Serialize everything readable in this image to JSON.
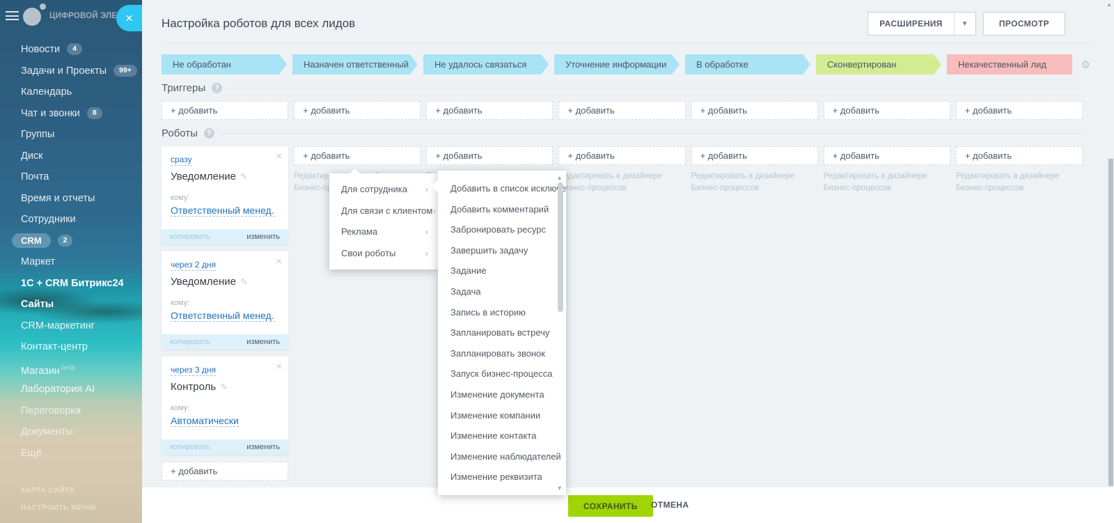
{
  "colors": {
    "stage_blue": "#a9e3f6",
    "stage_green": "#d3ec92",
    "stage_red": "#f9bcbc",
    "accent_cyan": "#2fc7f1",
    "save_green": "#9fd502",
    "link_blue": "#2272b9"
  },
  "sidebar": {
    "logo_text": "ЦИФРОВОЙ ЭЛЕМЕНТ",
    "items": [
      {
        "label": "Новости",
        "badge": "4"
      },
      {
        "label": "Задачи и Проекты",
        "badge": "99+"
      },
      {
        "label": "Календарь"
      },
      {
        "label": "Чат и звонки",
        "badge": "8"
      },
      {
        "label": "Группы"
      },
      {
        "label": "Диск"
      },
      {
        "label": "Почта"
      },
      {
        "label": "Время и отчеты"
      },
      {
        "label": "Сотрудники"
      },
      {
        "label": "CRM",
        "badge": "2",
        "active": true
      },
      {
        "label": "Маркет"
      },
      {
        "label": "1С + CRM Битрикс24",
        "bold": true
      },
      {
        "label": "Сайты",
        "bold": true
      },
      {
        "label": "CRM-маркетинг"
      },
      {
        "label": "Контакт-центр"
      },
      {
        "label": "Магазин",
        "suffix": "beta"
      },
      {
        "label": "Лаборатория AI"
      },
      {
        "label": "Переговорка",
        "dim": true
      },
      {
        "label": "Документы",
        "dim": true
      },
      {
        "label": "Ещё",
        "dim": true
      }
    ],
    "footer_links": [
      "КАРТА САЙТА",
      "НАСТРОИТЬ МЕНЮ"
    ]
  },
  "header": {
    "title": "Настройка роботов для всех лидов",
    "extensions_label": "РАСШИРЕНИЯ",
    "view_label": "ПРОСМОТР"
  },
  "stages": [
    {
      "label": "Не обработан",
      "color": "#a9e3f6"
    },
    {
      "label": "Назначен ответственный",
      "color": "#a9e3f6"
    },
    {
      "label": "Не удалось связаться",
      "color": "#a9e3f6"
    },
    {
      "label": "Уточнение информации",
      "color": "#a9e3f6"
    },
    {
      "label": "В обработке",
      "color": "#a9e3f6"
    },
    {
      "label": "Сконвертирован",
      "color": "#d3ec92"
    },
    {
      "label": "Некачественный лид",
      "color": "#f9bcbc"
    }
  ],
  "triggers": {
    "title": "Триггеры",
    "add_label": "+ добавить"
  },
  "robots": {
    "title": "Роботы",
    "add_label": "+ добавить",
    "designer_hint": "Редактировать в дизайнере Бизнес-процессов",
    "cards": [
      {
        "when": "сразу",
        "name": "Уведомление",
        "to_label": "кому:",
        "to": "Ответственный менед...",
        "copy_label": "копировать",
        "edit_label": "изменить"
      },
      {
        "when": "через 2 дня",
        "name": "Уведомление",
        "to_label": "кому:",
        "to": "Ответственный менед...",
        "copy_label": "копировать",
        "edit_label": "изменить"
      },
      {
        "when": "через 3 дня",
        "name": "Контроль",
        "to_label": "кому:",
        "to": "Автоматически",
        "copy_label": "копировать",
        "edit_label": "изменить"
      }
    ]
  },
  "robot_menu": {
    "items": [
      {
        "label": "Для сотрудника",
        "active": true
      },
      {
        "label": "Для связи с клиентом"
      },
      {
        "label": "Реклама"
      },
      {
        "label": "Свои роботы"
      }
    ],
    "submenu": [
      "Добавить в список исключений",
      "Добавить комментарий",
      "Забронировать ресурс",
      "Завершить задачу",
      "Задание",
      "Задача",
      "Запись в историю",
      "Запланировать встречу",
      "Запланировать звонок",
      "Запуск бизнес-процесса",
      "Изменение документа",
      "Изменение компании",
      "Изменение контакта",
      "Изменение наблюдателей",
      "Изменение реквизита"
    ]
  },
  "footer_bar": {
    "save_label": "СОХРАНИТЬ",
    "cancel_label": "ОТМЕНА"
  }
}
